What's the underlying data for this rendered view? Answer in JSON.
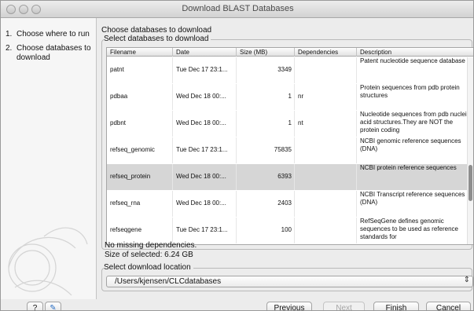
{
  "window": {
    "title": "Download BLAST Databases"
  },
  "steps": [
    {
      "num": "1.",
      "label": "Choose where to run"
    },
    {
      "num": "2.",
      "label": "Choose databases to download"
    }
  ],
  "main": {
    "heading": "Choose databases to download",
    "group_title": "Select databases to download",
    "columns": [
      "Filename",
      "Date",
      "Size (MB)",
      "Dependencies",
      "Description"
    ],
    "rows": [
      {
        "filename": "patnt",
        "date": "Tue Dec 17 23:1...",
        "size": "3349",
        "dependencies": "",
        "description": "Patent nucleotide sequence database"
      },
      {
        "filename": "pdbaa",
        "date": "Wed Dec 18 00:...",
        "size": "1",
        "dependencies": "nr",
        "description": "Protein sequences from pdb protein structures"
      },
      {
        "filename": "pdbnt",
        "date": "Wed Dec 18 00:...",
        "size": "1",
        "dependencies": "nt",
        "description": "Nucleotide sequences from pdb nucleic acid structures.They are NOT the protein coding"
      },
      {
        "filename": "refseq_genomic",
        "date": "Tue Dec 17 23:1...",
        "size": "75835",
        "dependencies": "",
        "description": "NCBI genomic reference sequences (DNA)"
      },
      {
        "filename": "refseq_protein",
        "date": "Wed Dec 18 00:...",
        "size": "6393",
        "dependencies": "",
        "description": "NCBI protein reference sequences",
        "selected": true
      },
      {
        "filename": "refseq_rna",
        "date": "Wed Dec 18 00:...",
        "size": "2403",
        "dependencies": "",
        "description": "NCBI Transcript reference sequences (DNA)"
      },
      {
        "filename": "refseqgene",
        "date": "Tue Dec 17 23:1...",
        "size": "100",
        "dependencies": "",
        "description": "RefSeqGene defines genomic sequences to be used as reference standards for"
      }
    ],
    "status_dependencies": "No missing dependencies.",
    "status_size": "Size of selected: 6.24 GB",
    "location_title": "Select download location",
    "location_value": "/Users/kjensen/CLCdatabases"
  },
  "footer": {
    "help_label": "?",
    "record_label": "✎",
    "previous_label": "Previous",
    "next_label": "Next",
    "finish_label": "Finish",
    "cancel_label": "Cancel"
  },
  "colors": {
    "selected_row": "#d6d6d6",
    "window_bg": "#ececec",
    "link_blue": "#2b6fc4"
  },
  "icons": [
    "close-icon",
    "minimize-icon",
    "zoom-icon",
    "help-icon",
    "record-icon",
    "chevron-updown-icon"
  ]
}
